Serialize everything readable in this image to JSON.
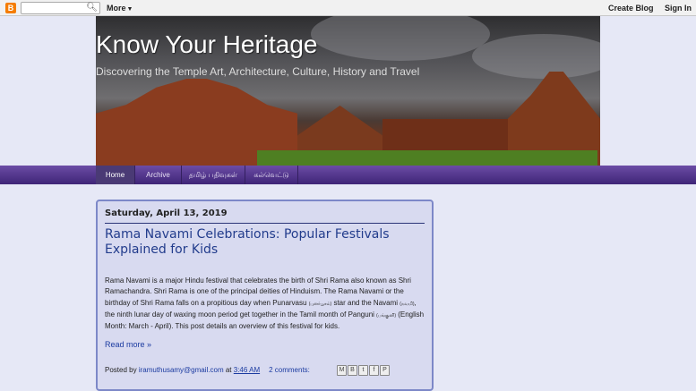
{
  "navbar": {
    "logo_letter": "B",
    "more_label": "More",
    "create_blog": "Create Blog",
    "sign_in": "Sign In"
  },
  "header": {
    "title": "Know Your Heritage",
    "description": "Discovering the Temple Art, Architecture, Culture, History and Travel"
  },
  "tabs": [
    {
      "label": "Home"
    },
    {
      "label": "Archive"
    },
    {
      "label": "தமிழ் பதிவுகள்"
    },
    {
      "label": "கல்வெட்டு"
    }
  ],
  "post": {
    "date": "Saturday, April 13, 2019",
    "title": "Rama Navami Celebrations: Popular Festivals Explained for Kids",
    "body_1": "Rama Navami is a major Hindu festival that celebrates the birth of Shri Rama also known as Shri Ramachandra.  Shri Rama is one of the principal deities of Hinduism. The Rama Navami or the birthday of Shri Rama falls on a propitious day when Punarvasu ",
    "tamil_1": "(புனர்பூசம்)",
    "body_2": " star and the Navami ",
    "tamil_2": "(நவமி)",
    "body_3": ", the ninth lunar day of waxing moon period get together in the Tamil month of Panguni ",
    "tamil_3": "(பங்குனி)",
    "body_4": " (English Month: March - April). This post details an overview of this festival for kids.",
    "read_more": "Read more »",
    "posted_by": "Posted by ",
    "author": "iramuthusamy@gmail.com",
    "at": " at ",
    "time": "3:46 AM",
    "comments": "2 comments:"
  },
  "share_icons": [
    "email-icon",
    "blogthis-icon",
    "twitter-icon",
    "facebook-icon",
    "pinterest-icon"
  ],
  "colors": {
    "page_bg": "#e6e8f6",
    "tab_bar": "#4b2f88",
    "post_bg": "#d8daf0",
    "post_border": "#7d88c8",
    "link": "#1a3aa0",
    "title": "#223c8c"
  }
}
